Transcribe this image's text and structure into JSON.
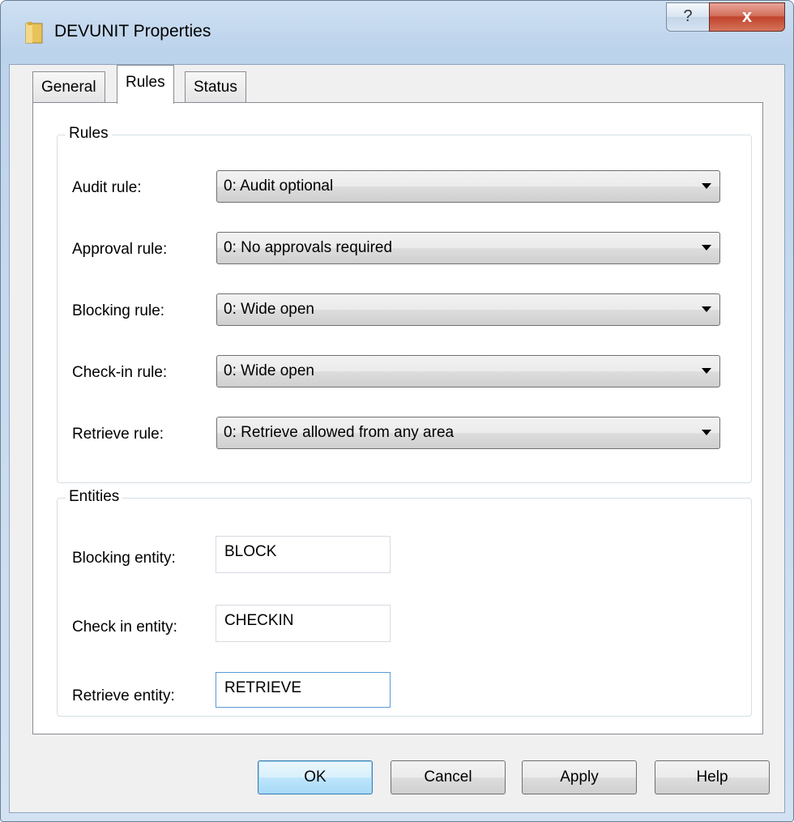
{
  "window": {
    "title": "DEVUNIT Properties",
    "help_glyph": "?",
    "close_glyph": "x",
    "icon": "folder-icon"
  },
  "tabs": [
    {
      "label": "General",
      "active": false
    },
    {
      "label": "Rules",
      "active": true
    },
    {
      "label": "Status",
      "active": false
    }
  ],
  "rules_group": {
    "caption": "Rules",
    "rows": [
      {
        "label": "Audit rule:",
        "value": "0:  Audit optional"
      },
      {
        "label": "Approval rule:",
        "value": "0:  No approvals required"
      },
      {
        "label": "Blocking rule:",
        "value": "0:  Wide open"
      },
      {
        "label": "Check-in rule:",
        "value": "0:  Wide open"
      },
      {
        "label": "Retrieve rule:",
        "value": "0:  Retrieve allowed from any area"
      }
    ]
  },
  "entities_group": {
    "caption": "Entities",
    "rows": [
      {
        "label": "Blocking entity:",
        "value": "BLOCK"
      },
      {
        "label": "Check in entity:",
        "value": "CHECKIN"
      },
      {
        "label": "Retrieve entity:",
        "value": "RETRIEVE"
      }
    ]
  },
  "buttons": {
    "ok": "OK",
    "cancel": "Cancel",
    "apply": "Apply",
    "help": "Help"
  },
  "colors": {
    "title_bg": "#c6d9ee",
    "close_button": "#c0432c",
    "default_button_border": "#3c7fb1",
    "focus_border": "#5b9ad9"
  }
}
